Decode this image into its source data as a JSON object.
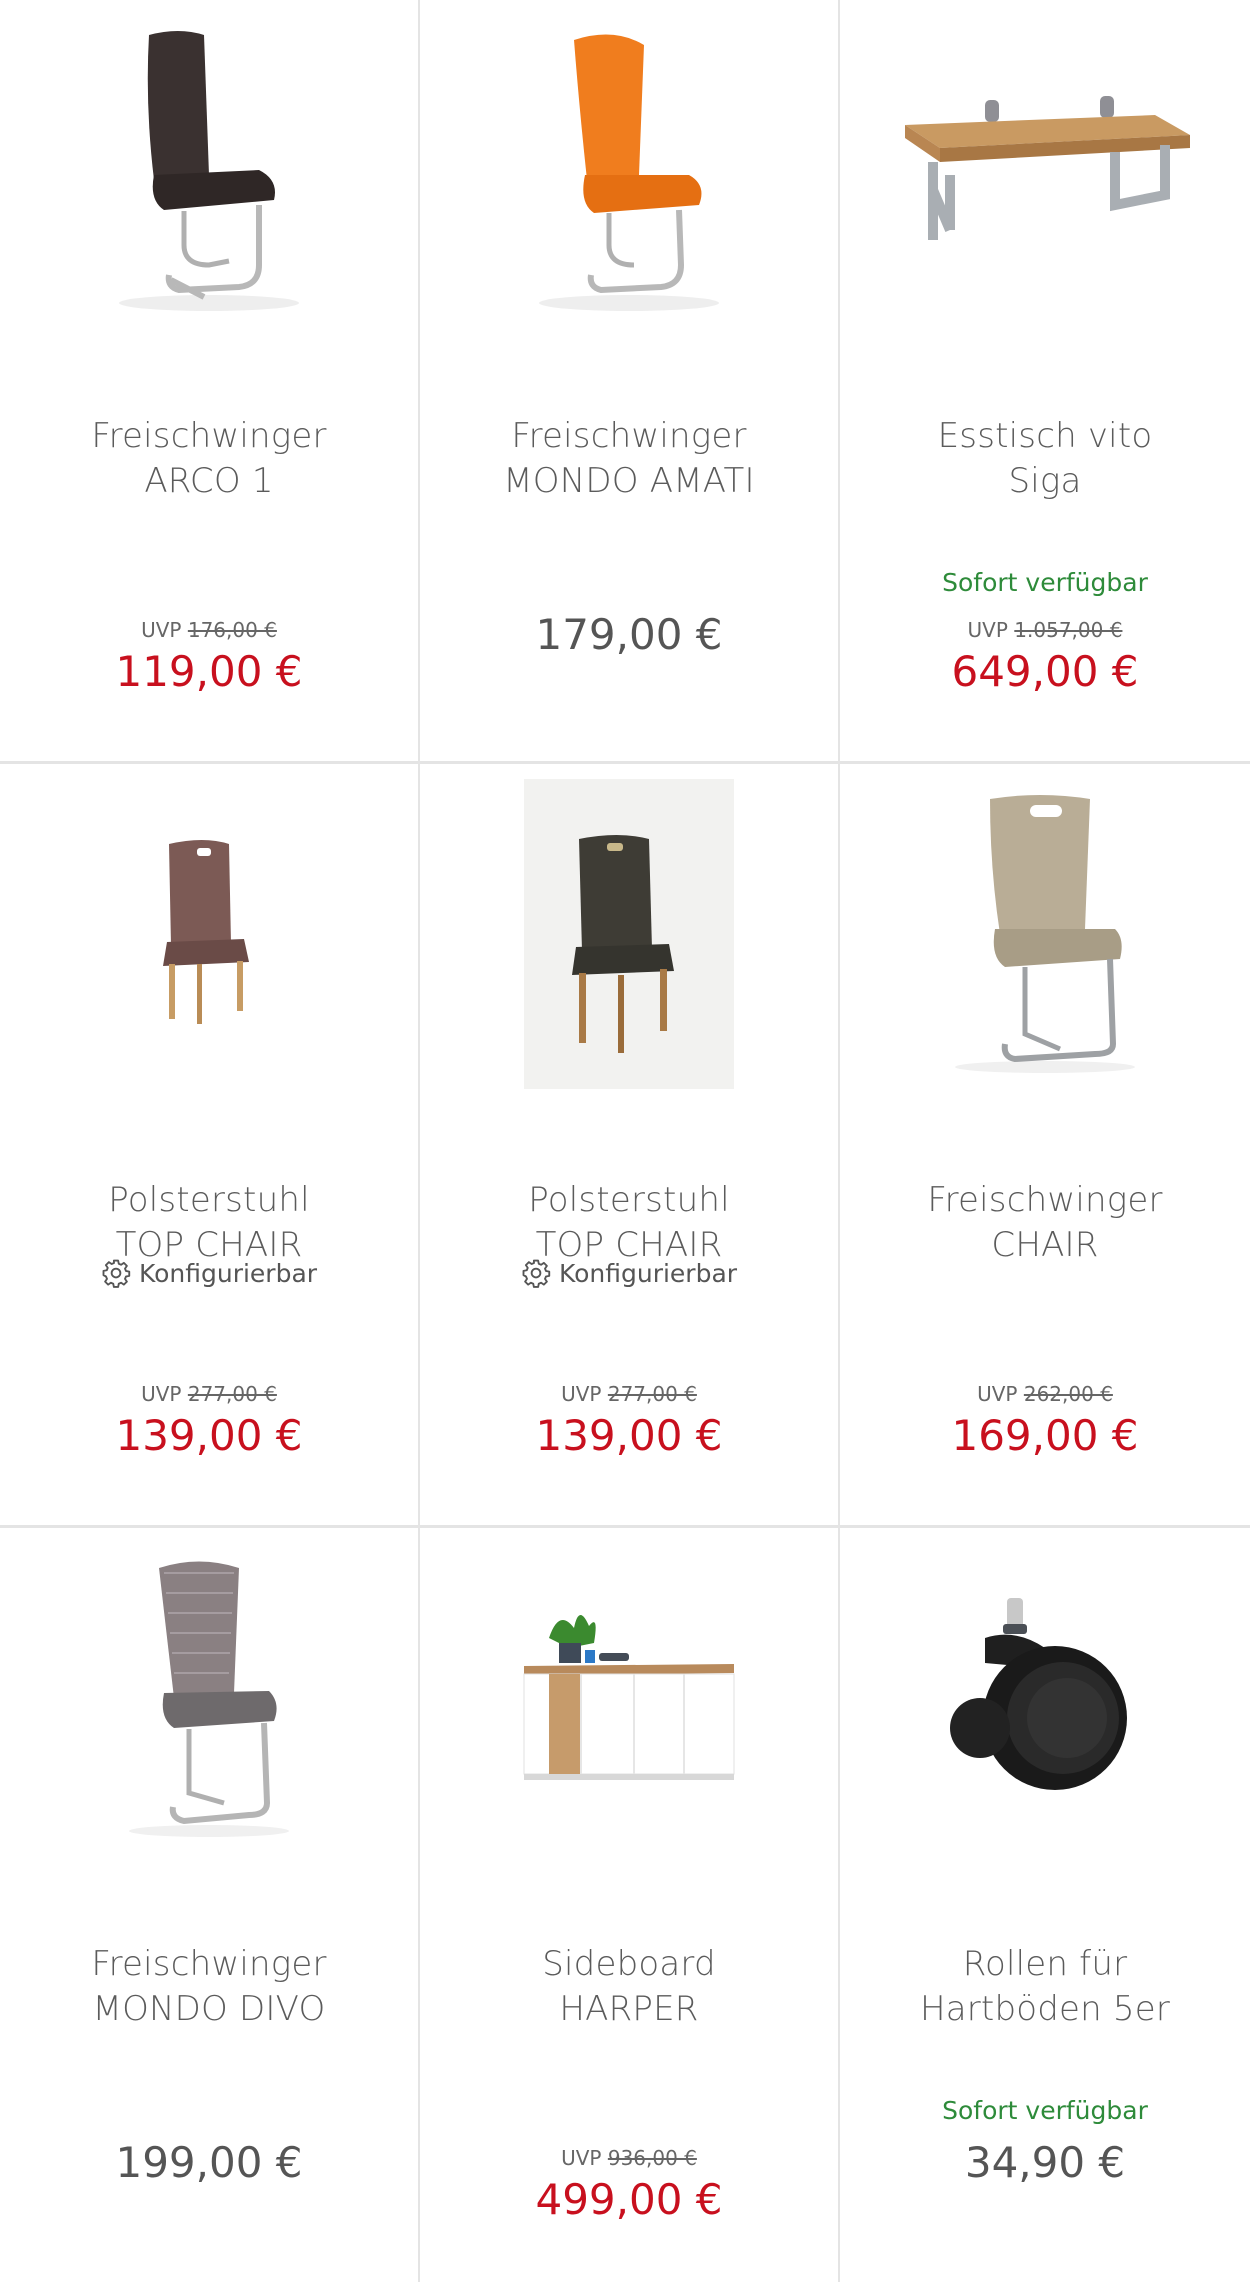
{
  "products": [
    {
      "name_line1": "Freischwinger",
      "name_line2": "ARCO 1",
      "uvp_label": "UVP",
      "uvp_price": "176,00 €",
      "price": "119,00 €",
      "configurable": "",
      "availability": "",
      "image_icon": "chair-cantilever-dark-icon"
    },
    {
      "name_line1": "Freischwinger",
      "name_line2": "MONDO AMATI",
      "uvp_label": "",
      "uvp_price": "",
      "price": "179,00 €",
      "configurable": "",
      "availability": "",
      "image_icon": "chair-cantilever-orange-icon"
    },
    {
      "name_line1": "Esstisch vito",
      "name_line2": "Siga",
      "uvp_label": "UVP",
      "uvp_price": "1.057,00 €",
      "price": "649,00 €",
      "configurable": "",
      "availability": "Sofort verfügbar",
      "image_icon": "dining-table-icon"
    },
    {
      "name_line1": "Polsterstuhl",
      "name_line2": "TOP CHAIR",
      "uvp_label": "UVP",
      "uvp_price": "277,00 €",
      "price": "139,00 €",
      "configurable": "Konfigurierbar",
      "availability": "",
      "image_icon": "upholstered-chair-brown-icon"
    },
    {
      "name_line1": "Polsterstuhl",
      "name_line2": "TOP CHAIR",
      "uvp_label": "UVP",
      "uvp_price": "277,00 €",
      "price": "139,00 €",
      "configurable": "Konfigurierbar",
      "availability": "",
      "image_icon": "upholstered-chair-dark-icon"
    },
    {
      "name_line1": "Freischwinger",
      "name_line2": "CHAIR",
      "uvp_label": "UVP",
      "uvp_price": "262,00 €",
      "price": "169,00 €",
      "configurable": "",
      "availability": "",
      "image_icon": "chair-cantilever-beige-icon"
    },
    {
      "name_line1": "Freischwinger",
      "name_line2": "MONDO DIVO",
      "uvp_label": "",
      "uvp_price": "",
      "price": "199,00 €",
      "configurable": "",
      "availability": "",
      "image_icon": "chair-cantilever-grey-icon"
    },
    {
      "name_line1": "Sideboard",
      "name_line2": "HARPER",
      "uvp_label": "UVP",
      "uvp_price": "936,00 €",
      "price": "499,00 €",
      "configurable": "",
      "availability": "",
      "image_icon": "sideboard-icon"
    },
    {
      "name_line1": "Rollen für",
      "name_line2": "Hartböden 5er",
      "uvp_label": "",
      "uvp_price": "",
      "price": "34,90 €",
      "configurable": "",
      "availability": "Sofort verfügbar",
      "image_icon": "caster-wheel-icon"
    }
  ],
  "colors": {
    "sale_price": "#c8101e",
    "regular_price": "#555555",
    "availability": "#2e8b3a",
    "divider": "#e4e4e4"
  }
}
